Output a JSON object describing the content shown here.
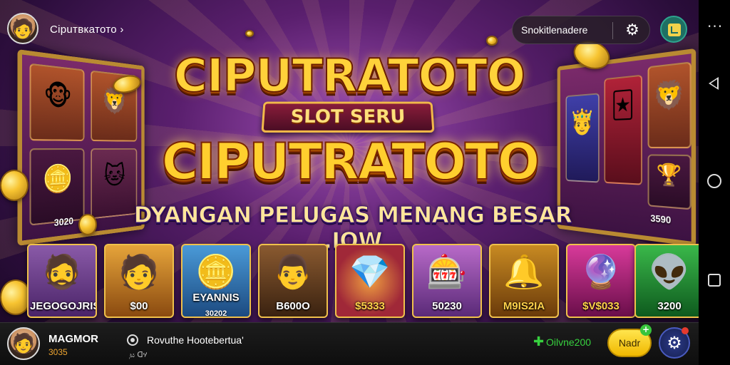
{
  "header": {
    "username": "Ciрuтвкатото ›",
    "search_text": "Snokitlenadere",
    "icons": [
      "avatar",
      "gear-icon",
      "menu-icon"
    ]
  },
  "logo": {
    "title_top": "CIPUTRATOTO",
    "subtitle": "SLOT SERU",
    "title_main": "CIPUTRATOTO",
    "tagline": "DYANGAN PELUGAS MENANG BESAR .IOW"
  },
  "reels": {
    "left_value": "3020",
    "right_value": "3590"
  },
  "tiles": [
    {
      "label": "JEGOGOJRIS",
      "pic": "🧔",
      "bg": "#6a3a8a"
    },
    {
      "label": "$00",
      "pic": "🧑",
      "bg": "#c8841c"
    },
    {
      "label": "EYANNIS",
      "sub": "30202",
      "pic": "🪙",
      "bg": "#2d6fa8"
    },
    {
      "label": "B600O",
      "pic": "👨",
      "bg": "#5a3a22"
    },
    {
      "label": "$5333",
      "pic": "💎",
      "bg": "#9a2530"
    },
    {
      "label": "50230",
      "pic": "🎰",
      "bg": "#7a3f8e"
    },
    {
      "label": "M9IS2IA",
      "pic": "🔔",
      "bg": "#8a5a12"
    },
    {
      "label": "$V$033",
      "pic": "🔮",
      "bg": "#8c1f6e"
    },
    {
      "label": "3200",
      "pic": "👽",
      "bg": "#1f7a2e"
    }
  ],
  "footer": {
    "player_name": "MAGMOR",
    "player_score": "3035",
    "news_text": "Rovuthe Hootebertua'",
    "news_sub": "᷊ಟ ᗡሃ",
    "balance": "Oilvne200",
    "add_label": "Nadr",
    "add_badge": "+"
  },
  "colors": {
    "accent_gold": "#ffcf2e",
    "balance_green": "#37d13f",
    "add_button": "#f0b800"
  }
}
